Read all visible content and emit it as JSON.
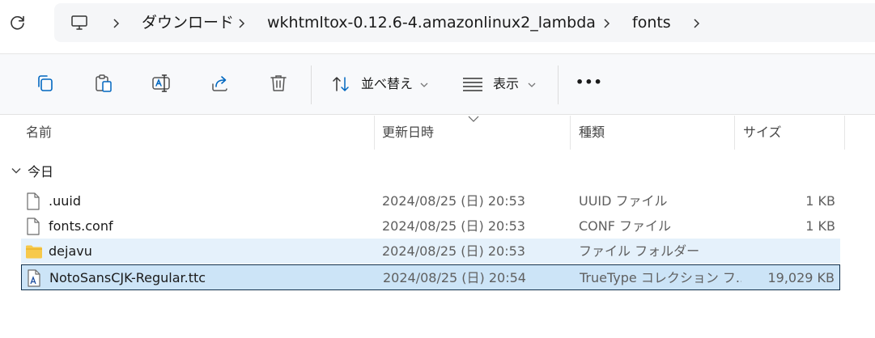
{
  "address_bar": {
    "breadcrumbs": [
      "ダウンロード",
      "wkhtmltox-0.12.6-4.amazonlinux2_lambda",
      "fonts"
    ]
  },
  "command_bar": {
    "sort_label": "並べ替え",
    "view_label": "表示",
    "more_label": "•••"
  },
  "columns": {
    "name": "名前",
    "modified": "更新日時",
    "type": "種類",
    "size": "サイズ"
  },
  "group": {
    "label": "今日"
  },
  "files": [
    {
      "name": ".uuid",
      "modified": "2024/08/25 (日) 20:53",
      "type": "UUID ファイル",
      "size": "1 KB",
      "icon": "file-icon",
      "state": "normal"
    },
    {
      "name": "fonts.conf",
      "modified": "2024/08/25 (日) 20:53",
      "type": "CONF ファイル",
      "size": "1 KB",
      "icon": "file-icon",
      "state": "normal"
    },
    {
      "name": "dejavu",
      "modified": "2024/08/25 (日) 20:53",
      "type": "ファイル フォルダー",
      "size": "",
      "icon": "folder-icon",
      "state": "hover"
    },
    {
      "name": "NotoSansCJK-Regular.ttc",
      "modified": "2024/08/25 (日) 20:54",
      "type": "TrueType コレクション フ...",
      "size": "19,029 KB",
      "icon": "font-file-icon",
      "state": "selected"
    }
  ],
  "colors": {
    "accent": "#0067c0",
    "row_hover": "#e5f1fb",
    "row_selected": "#cce4f7",
    "folder": "#f7c94b"
  }
}
